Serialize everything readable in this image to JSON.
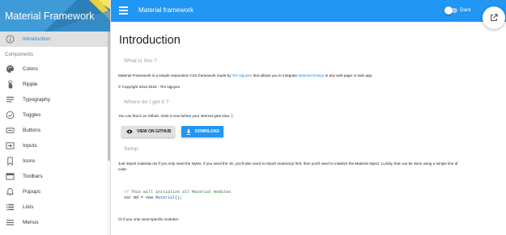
{
  "sidebar": {
    "brand_title": "Material Framework",
    "active_item": "Introduction",
    "section_label": "Components",
    "items": [
      {
        "label": "Colors",
        "icon": "palette-icon"
      },
      {
        "label": "Ripple",
        "icon": "touch-icon"
      },
      {
        "label": "Typography",
        "icon": "text-icon"
      },
      {
        "label": "Toggles",
        "icon": "check-circle-icon"
      },
      {
        "label": "Buttons",
        "icon": "button-icon"
      },
      {
        "label": "Inputs",
        "icon": "input-icon"
      },
      {
        "label": "Icons",
        "icon": "bookmark-icon"
      },
      {
        "label": "Toolbars",
        "icon": "toolbar-icon"
      },
      {
        "label": "Popups",
        "icon": "bell-icon"
      },
      {
        "label": "Lists",
        "icon": "list-icon"
      },
      {
        "label": "Menus",
        "icon": "menu-icon"
      }
    ]
  },
  "appbar": {
    "title": "Material framework",
    "dark_toggle_label": "Dark",
    "dark_on": false
  },
  "main": {
    "title": "Introduction",
    "what_heading": "What is this ?",
    "intro_prefix": "Material Framework is a simple responsive CSS framework made by ",
    "author_link": "Tim Nguyen",
    "intro_middle": " that allows you to integrate ",
    "md_link": "Material Design",
    "intro_suffix": " in any web page or web app.",
    "copyright": "© Copyright 2014-2015 - Tim Nguyen",
    "where_heading": "Where do I get it ?",
    "where_text": "You can find it on Github. Grab it now before your internet gets slow :)",
    "github_button": "VIEW ON GITHUB",
    "download_button": "DOWNLOAD",
    "setup_heading": "Setup",
    "setup_text_line1": "Just import material.css if you only need the styles. If you need the JS, you'll also need to import material.js first, then you'll need to initialize the Material object. Luckily, that can be done using a simple line of",
    "setup_text_line2": "code :",
    "code_comment": "// This will initialize all Material modules",
    "code_var": "var md = new ",
    "code_fn": "Material",
    "code_end": "();",
    "specific_text": "Or if you only need specific modules :"
  },
  "colors": {
    "primary": "#2196f3",
    "link": "#1e88e5"
  }
}
